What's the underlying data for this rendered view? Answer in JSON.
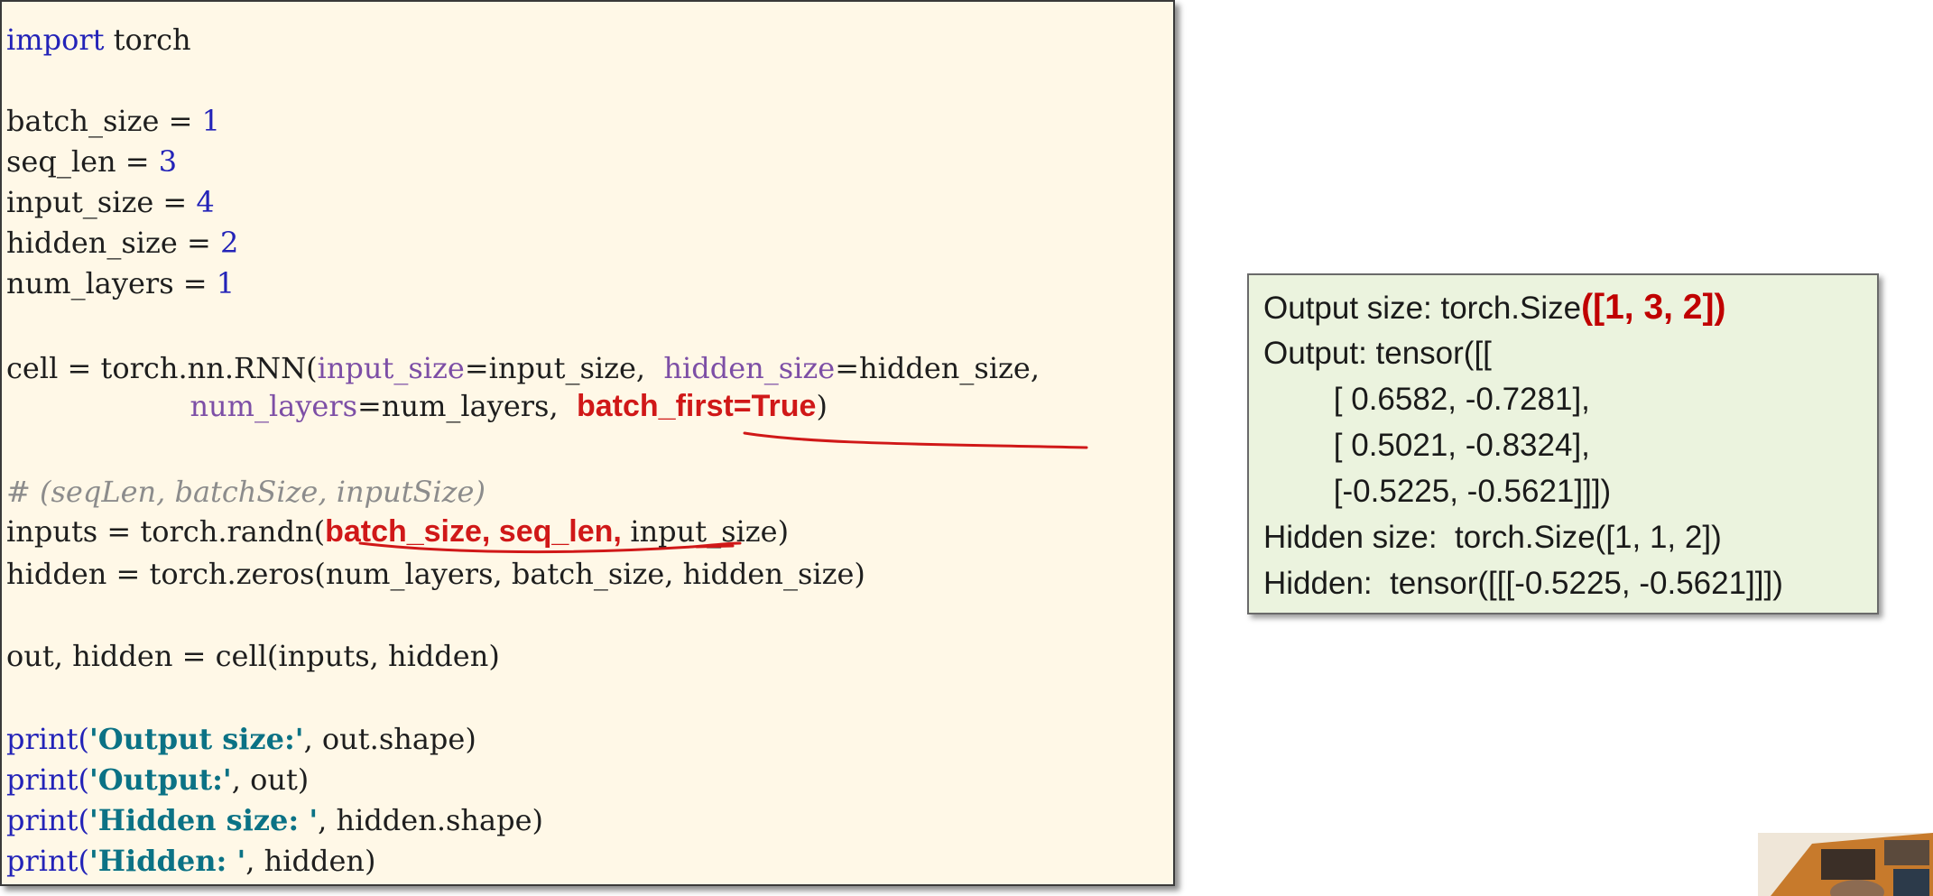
{
  "code": {
    "line_import": {
      "kw": "import",
      "rest": " torch"
    },
    "line_batch_size": {
      "name": "batch_size = ",
      "value": "1"
    },
    "line_seq_len": {
      "name": "seq_len = ",
      "value": "3"
    },
    "line_input_size": {
      "name": "input_size = ",
      "value": "4"
    },
    "line_hidden_size": {
      "name": "hidden_size = ",
      "value": "2"
    },
    "line_num_layers": {
      "name": "num_layers = ",
      "value": "1"
    },
    "line_cell_1": {
      "prefix": "cell = torch.nn.RNN(",
      "kw1": "input_size",
      "mid1": "=input_size,  ",
      "kw2": "hidden_size",
      "mid2": "=hidden_size,"
    },
    "line_cell_2": {
      "indent": "                    ",
      "kw": "num_layers",
      "mid": "=num_layers,  ",
      "highlight": "batch_first=True",
      "suffix": ")"
    },
    "line_comment": "# (seqLen, batchSize, inputSize)",
    "line_inputs": {
      "prefix": "inputs = torch.randn(",
      "highlight": "batch_size, seq_len, ",
      "suffix": "input_size)"
    },
    "line_hidden": "hidden = torch.zeros(num_layers, batch_size, hidden_size)",
    "line_call": "out, hidden = cell(inputs, hidden)",
    "print_lines": [
      {
        "fn": "print(",
        "str": "'Output size:'",
        "rest": ", out.shape)"
      },
      {
        "fn": "print(",
        "str": "'Output:'",
        "rest": ", out)"
      },
      {
        "fn": "print(",
        "str": "'Hidden size: '",
        "rest": ", hidden.shape)"
      },
      {
        "fn": "print(",
        "str": "'Hidden: '",
        "rest": ", hidden)"
      }
    ]
  },
  "output": {
    "size_label": "Output size: torch.Size",
    "size_value": "([1, 3, 2])",
    "output_label": "Output: tensor([[",
    "rows": [
      "        [ 0.6582, -0.7281],",
      "        [ 0.5021, -0.8324],",
      "        [-0.5225, -0.5621]]])"
    ],
    "hidden_size": "Hidden size:  torch.Size([1, 1, 2])",
    "hidden": "Hidden:  tensor([[[-0.5225, -0.5621]]])"
  },
  "colors": {
    "code_background": "#fff8e7",
    "output_background": "#ebf3de",
    "highlight_red": "#d01818",
    "number_blue": "#2323b8",
    "string_teal": "#0b7285"
  }
}
